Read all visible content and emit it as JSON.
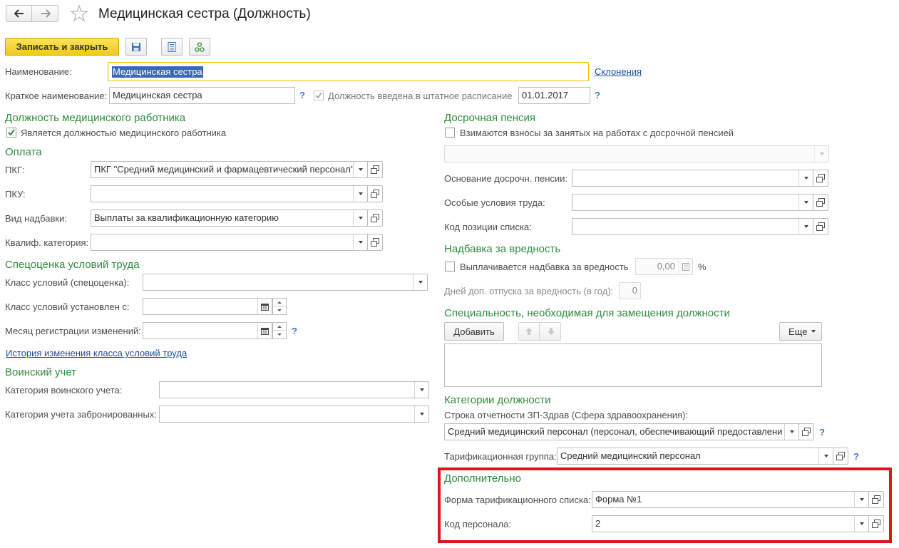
{
  "window": {
    "title": "Медицинская сестра (Должность)"
  },
  "toolbar": {
    "save_close": "Записать и закрыть"
  },
  "top": {
    "name_label": "Наименование:",
    "name_value": "Медицинская сестра",
    "declensions_link": "Склонения",
    "short_label": "Краткое наименование:",
    "short_value": "Медицинская сестра",
    "staff_checkbox_label": "Должность введена в штатное расписание",
    "staff_date": "01.01.2017",
    "help": "?"
  },
  "medical": {
    "title": "Должность медицинского работника",
    "checkbox_label": "Является должностью медицинского работника"
  },
  "payment": {
    "title": "Оплата",
    "pkg_label": "ПКГ:",
    "pkg_value": "ПКГ \"Средний медицинский и фармацевтический персонал\"",
    "pku_label": "ПКУ:",
    "pku_value": "",
    "bonus_type_label": "Вид надбавки:",
    "bonus_type_value": "Выплаты за квалификационную категорию",
    "qual_label": "Квалиф. категория:",
    "qual_value": ""
  },
  "special_assessment": {
    "title": "Спецоценка условий труда",
    "class_label": "Класс условий (спецоценка):",
    "class_set_label": "Класс условий установлен с:",
    "month_label": "Месяц регистрации изменений:",
    "history_link": "История изменения класса условий труда"
  },
  "military": {
    "title": "Воинский учет",
    "category_label": "Категория воинского учета:",
    "reserved_label": "Категория учета забронированных:"
  },
  "early_pension": {
    "title": "Досрочная пенсия",
    "checkbox_label": "Взимаются взносы за занятых на работах с досрочной пенсией",
    "basis_label": "Основание досрочн. пенсии:",
    "conditions_label": "Особые условия труда:",
    "position_code_label": "Код позиции списка:"
  },
  "harm": {
    "title": "Надбавка за вредность",
    "checkbox_label": "Выплачивается надбавка за вредность",
    "amount": "0,00",
    "percent": "%",
    "days_label": "Дней доп. отпуска за вредность (в год):",
    "days_value": "0"
  },
  "specialty": {
    "title": "Специальность, необходимая для замещения должности",
    "add_button": "Добавить",
    "more_button": "Еще"
  },
  "categories": {
    "title": "Категории должности",
    "report_line_label": "Строка отчетности ЗП-Здрав (Сфера здравоохранения):",
    "report_line_value": "Средний медицинский персонал (персонал, обеспечивающий предоставление",
    "tariff_group_label": "Тарификационная группа:",
    "tariff_group_value": "Средний медицинский персонал"
  },
  "additional": {
    "title": "Дополнительно",
    "form_label": "Форма тарификационного списка:",
    "form_value": "Форма №1",
    "staff_code_label": "Код персонала:",
    "staff_code_value": "2",
    "highlight_color": "#e0151c"
  }
}
